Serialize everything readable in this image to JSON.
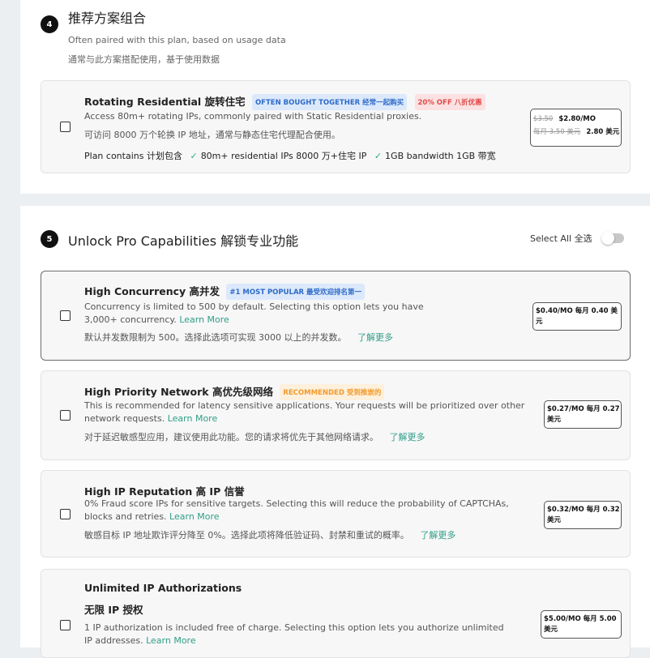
{
  "section4": {
    "number": "4",
    "title": "推荐方案组合",
    "subtitle_en": "Often paired with this plan, based on usage data",
    "subtitle_zh": "通常与此方案搭配使用，基于使用数据"
  },
  "rotating": {
    "title": "Rotating Residential 旋转住宅",
    "badge_together": "OFTEN BOUGHT TOGETHER 经常一起购买",
    "badge_off": "20% OFF 八折优惠",
    "desc_en": "Access 80m+ rotating IPs, commonly paired with Static Residential proxies.",
    "desc_zh": "可访问 8000 万个轮换 IP 地址，通常与静态住宅代理配合使用。",
    "contains_label": "Plan contains 计划包含",
    "contains_items": [
      "80m+ residential IPs 8000 万+住宅 IP",
      "1GB bandwidth 1GB 带宽"
    ],
    "old_price": "$3.50",
    "new_price": "$2.80/MO",
    "old_price_zh": "每月 3.50 美元",
    "new_price_zh": "2.80 美元"
  },
  "section5": {
    "number": "5",
    "title": "Unlock Pro Capabilities 解锁专业功能",
    "select_all": "Select All 全选"
  },
  "learn_more_en": "Learn More",
  "learn_more_zh": "了解更多",
  "options": [
    {
      "title": "High Concurrency 高并发",
      "badge": "#1 MOST POPULAR 最受欢迎排名第一",
      "desc_en": "Concurrency is limited to 500 by default. Selecting this option lets you have 3,000+ concurrency.",
      "desc_zh": "默认并发数限制为 500。选择此选项可实现 3000 以上的并发数。",
      "price_line1": "$0.40/MO 每月 0.40 美",
      "price_line2": "元"
    },
    {
      "title": "High Priority Network 高优先级网络",
      "badge": "RECOMMENDED 受到推崇的",
      "desc_en": "This is recommended for latency sensitive applications. Your requests will be prioritized over other network requests.",
      "desc_zh": "对于延迟敏感型应用，建议使用此功能。您的请求将优先于其他网络请求。",
      "price_line1": "$0.27/MO 每月 0.27",
      "price_line2": "美元"
    },
    {
      "title": "High IP Reputation 高 IP 信誉",
      "desc_en": "0% Fraud score IPs for sensitive targets. Selecting this will reduce the probability of CAPTCHAs, blocks and retries.",
      "desc_zh": "敏感目标 IP 地址欺诈评分降至 0%。选择此项将降低验证码、封禁和重试的概率。",
      "price_line1": "$0.32/MO 每月 0.32",
      "price_line2": "美元"
    },
    {
      "title": "Unlimited IP Authorizations",
      "title_zh": "无限 IP 授权",
      "desc_en": "1 IP authorization is included free of charge. Selecting this option lets you authorize unlimited IP addresses.",
      "price_line1": "$5.00/MO 每月 5.00",
      "price_line2": "美元"
    }
  ]
}
